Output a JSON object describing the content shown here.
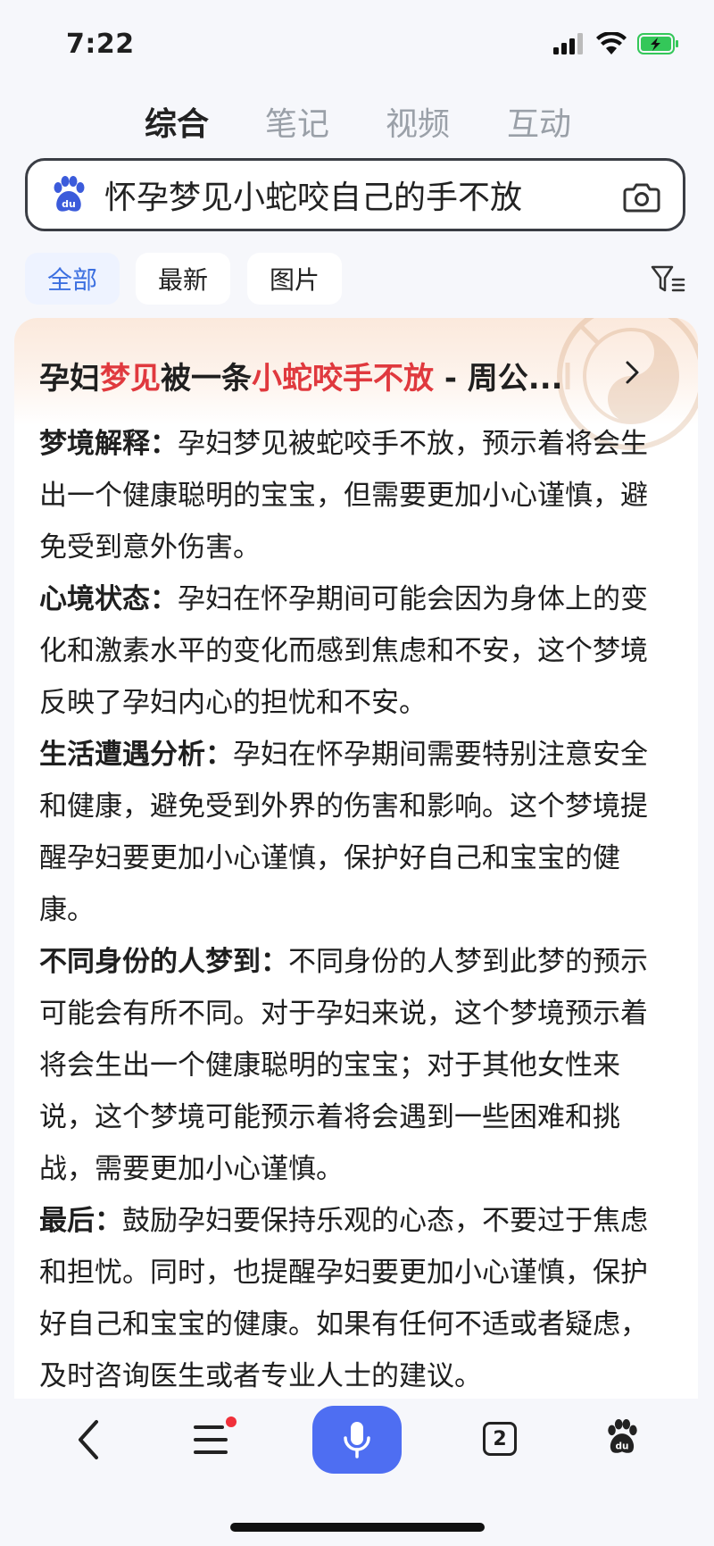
{
  "status_bar": {
    "time": "7:22",
    "icons": [
      "signal-icon",
      "wifi-icon",
      "battery-charging-icon"
    ],
    "battery_color": "#34c759"
  },
  "tabs": [
    {
      "label": "综合",
      "active": true
    },
    {
      "label": "笔记",
      "active": false
    },
    {
      "label": "视频",
      "active": false
    },
    {
      "label": "互动",
      "active": false
    }
  ],
  "search": {
    "query": "怀孕梦见小蛇咬自己的手不放",
    "logo_icon": "baidu-paw-icon",
    "camera_icon": "camera-icon"
  },
  "filters": {
    "chips": [
      {
        "label": "全部",
        "active": true
      },
      {
        "label": "最新",
        "active": false
      },
      {
        "label": "图片",
        "active": false
      }
    ],
    "filter_icon": "filter-icon"
  },
  "result_card": {
    "title_parts": [
      "孕妇",
      "梦见",
      "被一条",
      "小蛇咬手不放",
      " - 周公..."
    ],
    "highlight_color": "#e0393e",
    "sections": [
      {
        "label": "梦境解释：",
        "text": "孕妇梦见被蛇咬手不放，预示着将会生出一个健康聪明的宝宝，但需要更加小心谨慎，避免受到意外伤害。"
      },
      {
        "label": "心境状态：",
        "text": "孕妇在怀孕期间可能会因为身体上的变化和激素水平的变化而感到焦虑和不安，这个梦境反映了孕妇内心的担忧和不安。"
      },
      {
        "label": "生活遭遇分析：",
        "text": "孕妇在怀孕期间需要特别注意安全和健康，避免受到外界的伤害和影响。这个梦境提醒孕妇要更加小心谨慎，保护好自己和宝宝的健康。"
      },
      {
        "label": "不同身份的人梦到：",
        "text": "不同身份的人梦到此梦的预示可能会有所不同。对于孕妇来说，这个梦境预示着将会生出一个健康聪明的宝宝；对于其他女性来说，这个梦境可能预示着将会遇到一些困难和挑战，需要更加小心谨慎。"
      },
      {
        "label": "最后：",
        "text": "鼓励孕妇要保持乐观的心态，不要过于焦虑和担忧。同时，也提醒孕妇要更加小心谨慎，保护好自己和宝宝的健康。如果有任何不适或者疑虑，及时咨询医生或者专业人士的建议。"
      }
    ]
  },
  "bottom_bar": {
    "tab_count": "2",
    "accent_color": "#4e6ef2",
    "notification_dot_color": "#f0303a",
    "icons": [
      "back-icon",
      "menu-icon",
      "mic-icon",
      "tabs-icon",
      "baidu-paw-icon"
    ]
  }
}
